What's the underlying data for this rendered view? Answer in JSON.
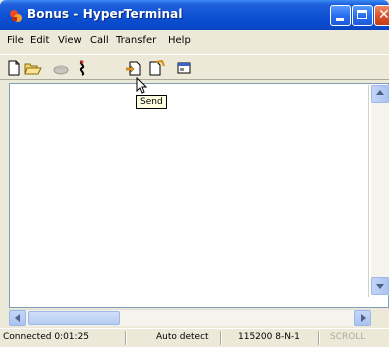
{
  "window": {
    "title": "Bonus - HyperTerminal"
  },
  "menu": {
    "items": [
      "File",
      "Edit",
      "View",
      "Call",
      "Transfer",
      "Help"
    ]
  },
  "toolbar": {
    "buttons": [
      {
        "icon": "new-document-icon"
      },
      {
        "icon": "open-folder-icon"
      },
      {
        "icon": "dial-phone-icon"
      },
      {
        "icon": "disconnect-icon"
      },
      {
        "icon": "send-file-icon"
      },
      {
        "icon": "receive-file-icon"
      },
      {
        "icon": "properties-icon"
      }
    ]
  },
  "tooltip": {
    "text": "Send"
  },
  "status": {
    "connected": "Connected 0:01:25",
    "detect": "Auto detect",
    "baud": "115200 8-N-1",
    "scroll": "SCROLL"
  },
  "colors": {
    "titlebar": "#0b4fd3",
    "window_bg": "#ece9d8",
    "terminal_bg": "#ffffff",
    "tooltip_bg": "#ffffe1"
  }
}
